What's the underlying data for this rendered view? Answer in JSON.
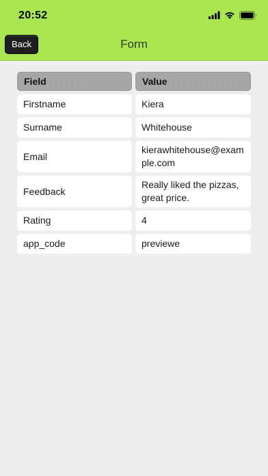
{
  "status_bar": {
    "time": "20:52",
    "icons": [
      "cellular-signal-icon",
      "wifi-icon",
      "battery-icon"
    ]
  },
  "nav": {
    "back_label": "Back",
    "title": "Form"
  },
  "table": {
    "headers": {
      "field": "Field",
      "value": "Value"
    },
    "rows": [
      {
        "field": "Firstname",
        "value": "Kiera"
      },
      {
        "field": "Surname",
        "value": "Whitehouse"
      },
      {
        "field": "Email",
        "value": "kierawhitehouse@example.com"
      },
      {
        "field": "Feedback",
        "value": "Really liked the pizzas, great price."
      },
      {
        "field": "Rating",
        "value": "4"
      },
      {
        "field": "app_code",
        "value": "previewe"
      }
    ]
  },
  "colors": {
    "nav_background": "#a9e651",
    "page_background": "#eeeeee",
    "header_cell": "#a8a8a8",
    "back_button": "#1f1f1f"
  }
}
